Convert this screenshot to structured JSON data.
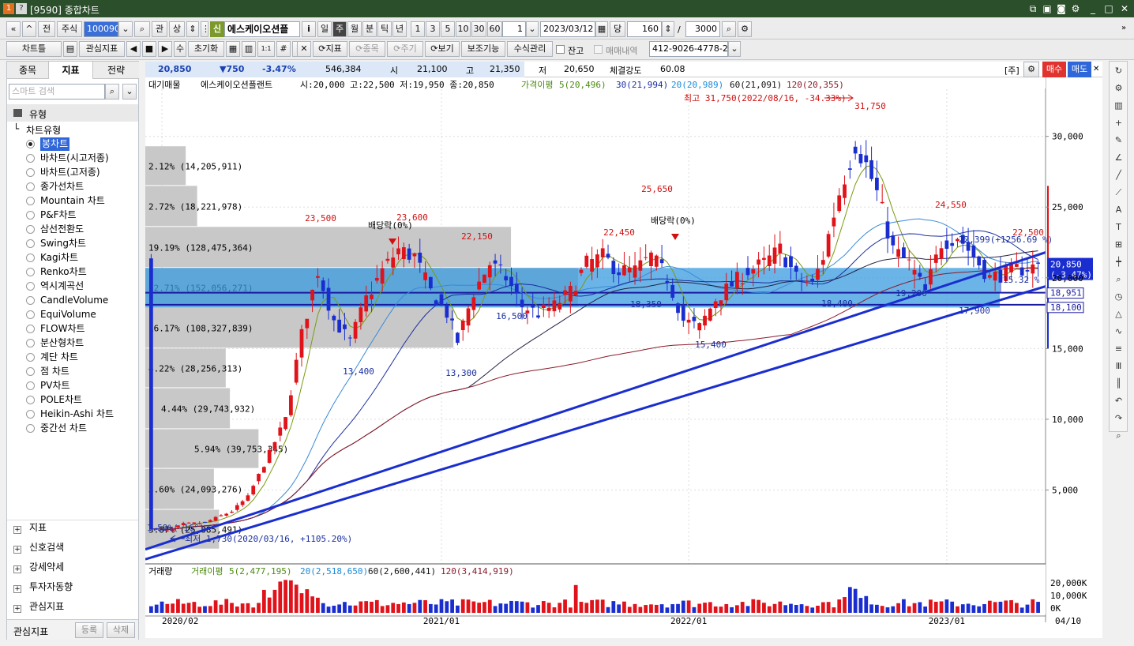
{
  "window": {
    "title": "[9590] 종합차트"
  },
  "toolbar1": {
    "jeon": "전",
    "jusik": "주식",
    "code": "100090",
    "gwan": "관",
    "sang": "상",
    "sin": "신",
    "stock_name": "에스케이오션플",
    "info": "i",
    "periods": [
      "일",
      "주",
      "월",
      "분",
      "틱",
      "년"
    ],
    "active_period": "주",
    "minutes": [
      "1",
      "3",
      "5",
      "10",
      "30",
      "60"
    ],
    "interval_value": "1",
    "date": "2023/03/12",
    "dang": "당",
    "count": "160",
    "max_count": "3000"
  },
  "toolbar2": {
    "chartteul": "차트틀",
    "gwansim": "관심지표",
    "su": "수",
    "reset": "초기화",
    "jipyo": "지표",
    "jongmok": "종목",
    "jugi": "주기",
    "bogi": "보기",
    "bojo": "보조기능",
    "susik": "수식관리",
    "janggo": "잔고",
    "maemae": "매매내역",
    "account": "412-9026-4778-2"
  },
  "left": {
    "tabs": [
      "종목",
      "지표",
      "전략"
    ],
    "active_tab": "지표",
    "search_placeholder": "스마트 검색",
    "group": "유형",
    "subgroup": "차트유형",
    "items": [
      "봉차트",
      "바차트(시고저종)",
      "바차트(고저종)",
      "종가선차트",
      "Mountain 차트",
      "P&F차트",
      "삼선전환도",
      "Swing차트",
      "Kagi차트",
      "Renko차트",
      "역시계곡선",
      "CandleVolume",
      "EquiVolume",
      "FLOW차트",
      "분산형차트",
      "계단 차트",
      "점 차트",
      "PV차트",
      "POLE차트",
      "Heikin-Ashi 차트",
      "중간선 차트"
    ],
    "selected": "봉차트",
    "sections": [
      "지표",
      "신호검색",
      "강세약세",
      "투자자동향",
      "관심지표"
    ],
    "footer": {
      "label": "관심지표",
      "register": "등록",
      "delete": "삭제"
    }
  },
  "quote": {
    "price": "20,850",
    "change": "▼750",
    "rate": "-3.47%",
    "volume": "546,384",
    "open_label": "시",
    "open": "21,100",
    "high_label": "고",
    "high": "21,350",
    "low_label": "저",
    "low": "20,650",
    "strength_label": "체결강도",
    "strength": "60.08",
    "ju": "[주]",
    "buy": "매수",
    "sell": "매도"
  },
  "legend": {
    "prefix": "대기매물",
    "name": "에스케이오션플랜트",
    "ohlc": "시:20,000 고:22,500 저:19,950 종:20,850",
    "ma_label": "가격이평",
    "ma5": "5(20,496)",
    "ma20": "20(20,989)",
    "ma30": "30(21,994)",
    "ma60": "60(21,091)",
    "ma120": "120(20,355)"
  },
  "vol_legend": {
    "label": "거래량",
    "ma_label": "거래이평",
    "ma5": "5(2,477,195)",
    "ma20": "20(2,518,650)",
    "ma60": "60(2,600,441)",
    "ma120": "120(3,414,919)"
  },
  "annotations": {
    "max": "최고 31,750(2022/08/16, -34.33%)",
    "min": "최저 1,730(2020/03/16, +1105.20%)",
    "div1": "배당락(0%)",
    "div2": "배당락(0%)",
    "angle": "1.59%( 16°)",
    "trend_up": "22,399(+1256.69 %)",
    "trend_pct": "15.32 %",
    "cur_price": "20,850",
    "cur_rate": "(-3.47%)",
    "box_top": "18,951",
    "box_bot": "18,100"
  },
  "chart_data": [
    {
      "type": "candlestick",
      "title": "에스케이오션플랜트",
      "x_ticks": [
        "2020/02",
        "2021/01",
        "2022/01",
        "2023/01"
      ],
      "end_label": "04/10",
      "y_ticks": [
        "5,000",
        "10,000",
        "15,000",
        "20,000",
        "25,000",
        "30,000"
      ],
      "ylim": [
        0,
        33500
      ],
      "highs": [
        "23,500",
        "23,600",
        "22,150",
        "25,650",
        "22,450",
        "31,750",
        "24,550",
        "22,500"
      ],
      "lows": [
        "13,400",
        "13,300",
        "16,500",
        "18,350",
        "15,400",
        "18,400",
        "19,200",
        "17,900"
      ],
      "volume_profile": [
        {
          "pct": "2.12% (14,205,911)",
          "low": 26500,
          "high": 29300,
          "share": 2.12
        },
        {
          "pct": "2.72% (18,221,978)",
          "low": 23600,
          "high": 26500,
          "share": 2.72
        },
        {
          "pct": "19.19% (128,475,364)",
          "low": 20700,
          "high": 23600,
          "share": 19.19
        },
        {
          "pct": "22.71% (152,056,271)",
          "low": 17900,
          "high": 20700,
          "share": 22.71
        },
        {
          "pct": "16.17% (108,327,839)",
          "low": 15000,
          "high": 17900,
          "share": 16.17
        },
        {
          "pct": "4.22% (28,256,313)",
          "low": 12200,
          "high": 15000,
          "share": 4.22
        },
        {
          "pct": "4.44% (29,743,932)",
          "low": 9300,
          "high": 12200,
          "share": 4.44
        },
        {
          "pct": "5.94% (39,753,345)",
          "low": 6500,
          "high": 9300,
          "share": 5.94
        },
        {
          "pct": "3.60% (24,093,276)",
          "low": 3600,
          "high": 6500,
          "share": 3.6
        },
        {
          "pct": "3.87% (25,885,491)",
          "low": 800,
          "high": 3600,
          "share": 3.87
        }
      ]
    },
    {
      "type": "bar",
      "title": "거래량",
      "y_ticks": [
        "20,000K",
        "10,000K",
        "0K"
      ]
    }
  ]
}
